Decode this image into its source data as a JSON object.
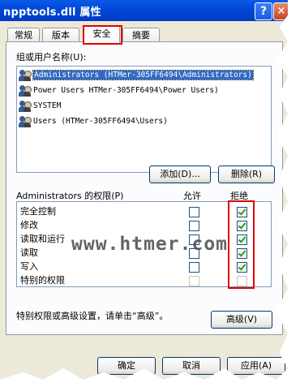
{
  "window": {
    "title": "npptools.dll 属性",
    "help_glyph": "?",
    "close_glyph": "×"
  },
  "tabs": [
    {
      "label": "常规",
      "active": false
    },
    {
      "label": "版本",
      "active": false
    },
    {
      "label": "安全",
      "active": true
    },
    {
      "label": "摘要",
      "active": false
    }
  ],
  "users": {
    "label": "组或用户名称(U):",
    "items": [
      {
        "name": "Administrators (HTMer-305FF6494\\Administrators)",
        "selected": true
      },
      {
        "name": "Power Users  HTMer-305FF6494\\Power Users)",
        "selected": false
      },
      {
        "name": "SYSTEM",
        "selected": false
      },
      {
        "name": "Users (HTMer-305FF6494\\Users)",
        "selected": false
      }
    ],
    "add_label": "添加(D)...",
    "remove_label": "删除(R)"
  },
  "permissions": {
    "header": "Administrators 的权限(P)",
    "allow_header": "允许",
    "deny_header": "拒绝",
    "rows": [
      {
        "label": "完全控制",
        "allow": false,
        "deny": true
      },
      {
        "label": "修改",
        "allow": false,
        "deny": true
      },
      {
        "label": "读取和运行",
        "allow": false,
        "deny": true
      },
      {
        "label": "读取",
        "allow": false,
        "deny": true
      },
      {
        "label": "写入",
        "allow": false,
        "deny": true
      },
      {
        "label": "特别的权限",
        "allow": false,
        "deny": false
      }
    ]
  },
  "advanced": {
    "text": "特别权限或高级设置，请单击“高级”。",
    "button_label": "高级(V)"
  },
  "footer": {
    "ok_label": "确定",
    "cancel_label": "取消",
    "apply_label": "应用(A)"
  },
  "watermark": "www.htmer.com",
  "colors": {
    "titlebar": "#0047d6",
    "dialog_bg": "#ece9d8",
    "selection": "#316ac5",
    "highlight_box": "#e00000",
    "check_green": "#21a121"
  }
}
